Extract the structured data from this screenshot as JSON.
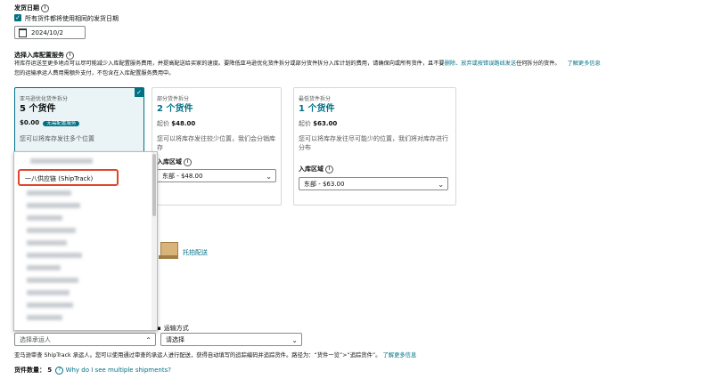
{
  "ship_date": {
    "heading": "发货日期",
    "same_date_checkbox_label": "所有货件都将使用相同的发货日期",
    "date_value": "2024/10/2"
  },
  "placement": {
    "heading": "选择入库配置服务",
    "desc_line1_a": "将库存运送至更多地点可以尽可能减少入库配置服务费用，并提高配送给买家的速度。要降低亚马逊优化货件拆分或部分货件拆分入库计划的费用，请确保向或所有货件，且不要",
    "desc_link1": "删除、放弃或按错误路线发送",
    "desc_line1_b": "任何拆分的货件。",
    "desc_link2": "了解更多信息",
    "desc_line2": "您的运输承运人费用需额外支付，不包含在入库配置服务费用中。"
  },
  "cards": [
    {
      "label": "亚马逊优化货件拆分",
      "count": "5 个货件",
      "price": "$0.00",
      "badge": "无需配置服务",
      "desc": "您可以将库存发往多个位置"
    },
    {
      "label": "部分货件拆分",
      "count": "2 个货件",
      "price_prefix": "起价",
      "price": "$48.00",
      "desc": "您可以将库存发往较少位置，我们会分销库存",
      "region_label": "入库区域",
      "region_value": "东部 - $48.00"
    },
    {
      "label": "最低货件拆分",
      "count": "1 个货件",
      "price_prefix": "起价",
      "price": "$63.00",
      "desc": "您可以将库存发往尽可能少的位置，我们将对库存进行分布",
      "region_label": "入库区域",
      "region_value": "东部 - $63.00"
    }
  ],
  "carrier_dropdown": {
    "highlighted_option": "一八供应链 (ShipTrack)"
  },
  "pallet_option": {
    "label": "托拍配送"
  },
  "shipping_method": {
    "label": "运输方式",
    "placeholder": "请选择"
  },
  "carrier_select": {
    "placeholder": "选择承运人"
  },
  "carrier_note": {
    "text": "亚马逊审查 ShipTrack 承运人。您可以使用通过审查的承运人进行配送，获得自动填写的追踪编码并追踪货件。路径为：“货件一览”>“追踪货件”。",
    "link": "了解更多信息"
  },
  "shipment_count": {
    "label": "货件数量：",
    "value": "5",
    "link": "Why do I see multiple shipments?"
  }
}
